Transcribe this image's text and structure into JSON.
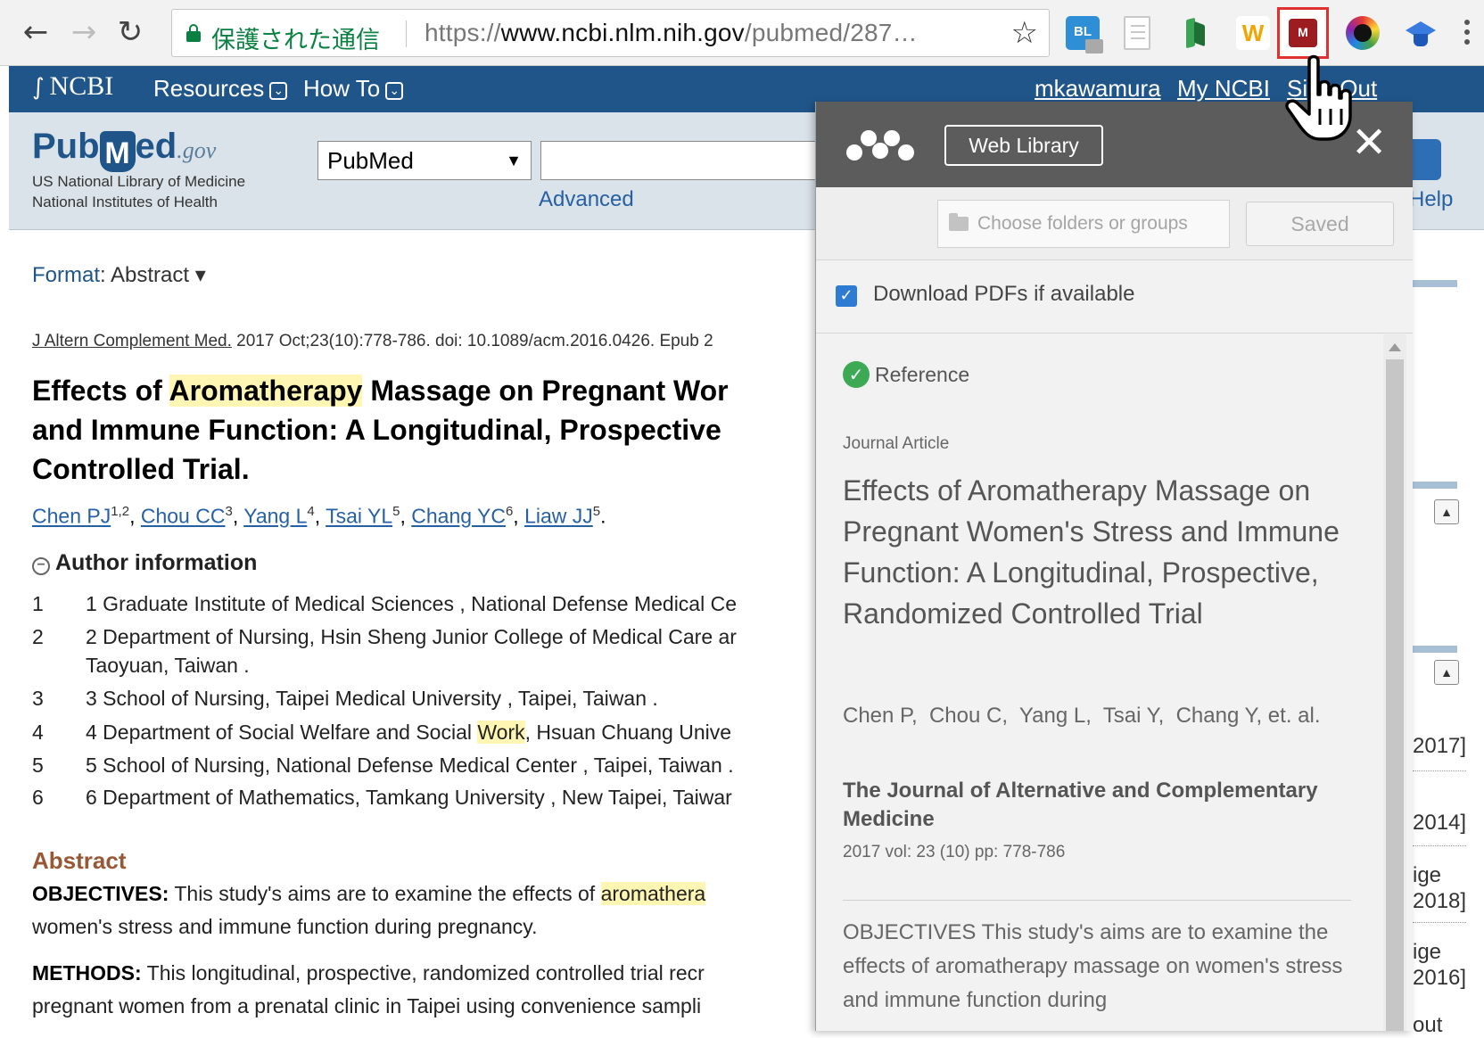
{
  "browser": {
    "secure_label": "保護された通信",
    "url_prefix": "https://",
    "url_host": "www.ncbi.nlm.nih.gov",
    "url_path": "/pubmed/287…",
    "ext_bl": "BL",
    "ext_w": "W",
    "ext_mendeley": "M"
  },
  "ncbi": {
    "logo": "NCBI",
    "menu_resources": "Resources",
    "menu_howto": "How To",
    "user": "mkawamura",
    "my_ncbi": "My NCBI",
    "sign_out": "Sign Out"
  },
  "pubmed": {
    "logo_pub": "Pub",
    "logo_m": "M",
    "logo_ed": "ed",
    "logo_gov": ".gov",
    "sub1": "US National Library of Medicine",
    "sub2": "National Institutes of Health",
    "db_selected": "PubMed",
    "advanced": "Advanced",
    "help": "Help"
  },
  "article": {
    "format_label": "Format",
    "format_value": ": Abstract",
    "citation_journal": "J Altern Complement Med.",
    "citation_rest": " 2017 Oct;23(10):778-786. doi: 10.1089/acm.2016.0426. Epub 2",
    "title_line1_pre": "Effects of ",
    "title_line1_hl": "Aromatherapy",
    "title_line1_post": " Massage on Pregnant Wor",
    "title_line2": "and Immune Function: A Longitudinal, Prospective",
    "title_line3": "Controlled Trial.",
    "authors": [
      {
        "name": "Chen PJ",
        "sup": "1,2"
      },
      {
        "name": "Chou CC",
        "sup": "3"
      },
      {
        "name": "Yang L",
        "sup": "4"
      },
      {
        "name": "Tsai YL",
        "sup": "5"
      },
      {
        "name": "Chang YC",
        "sup": "6"
      },
      {
        "name": "Liaw JJ",
        "sup": "5"
      }
    ],
    "author_info_label": "Author information",
    "affiliations": [
      {
        "num": "1",
        "text": "1 Graduate Institute of Medical Sciences , National Defense Medical Ce"
      },
      {
        "num": "2",
        "text": "2 Department of Nursing, Hsin Sheng Junior College of Medical Care ar",
        "cont": "Taoyuan, Taiwan ."
      },
      {
        "num": "3",
        "text": "3 School of Nursing, Taipei Medical University , Taipei, Taiwan ."
      },
      {
        "num": "4",
        "text_pre": "4 Department of Social Welfare and Social ",
        "text_hl": "Work",
        "text_post": ", Hsuan Chuang Unive"
      },
      {
        "num": "5",
        "text": "5 School of Nursing, National Defense Medical Center , Taipei, Taiwan ."
      },
      {
        "num": "6",
        "text": "6 Department of Mathematics, Tamkang University , New Taipei, Taiwar"
      }
    ],
    "abstract_label": "Abstract",
    "obj_label": "OBJECTIVES:",
    "obj_text_pre": " This study's aims are to examine the effects of ",
    "obj_text_hl": "aromathera",
    "obj_line2": "women's stress and immune function during pregnancy.",
    "methods_label": "METHODS:",
    "methods_text": " This longitudinal, prospective, randomized controlled trial recr",
    "methods_line2": "pregnant women from a prenatal clinic in Taipei using convenience sampli"
  },
  "sidebar": {
    "year1": "2017]",
    "year2": "2014]",
    "age1": "ige",
    "year3": "2018]",
    "age2": "ige",
    "year4": "2016]",
    "out": "out"
  },
  "popup": {
    "web_library": "Web Library",
    "close": "✕",
    "folder_placeholder": "Choose folders or groups",
    "saved": "Saved",
    "download_pdfs": "Download PDFs if available",
    "reference_label": "Reference",
    "type": "Journal Article",
    "title": "Effects of Aromatherapy Massage on Pregnant Women's Stress and Immune Function: A Longitudinal, Prospective, Randomized Controlled Trial",
    "authors": "Chen P,  Chou C,  Yang L,  Tsai Y,  Chang Y, et. al.",
    "journal": "The Journal of Alternative and Complementary Medicine",
    "volume": "2017 vol: 23 (10) pp: 778-786",
    "abstract": "OBJECTIVES This study's aims are to examine the effects of aromatherapy massage on women's stress and immune function during"
  }
}
